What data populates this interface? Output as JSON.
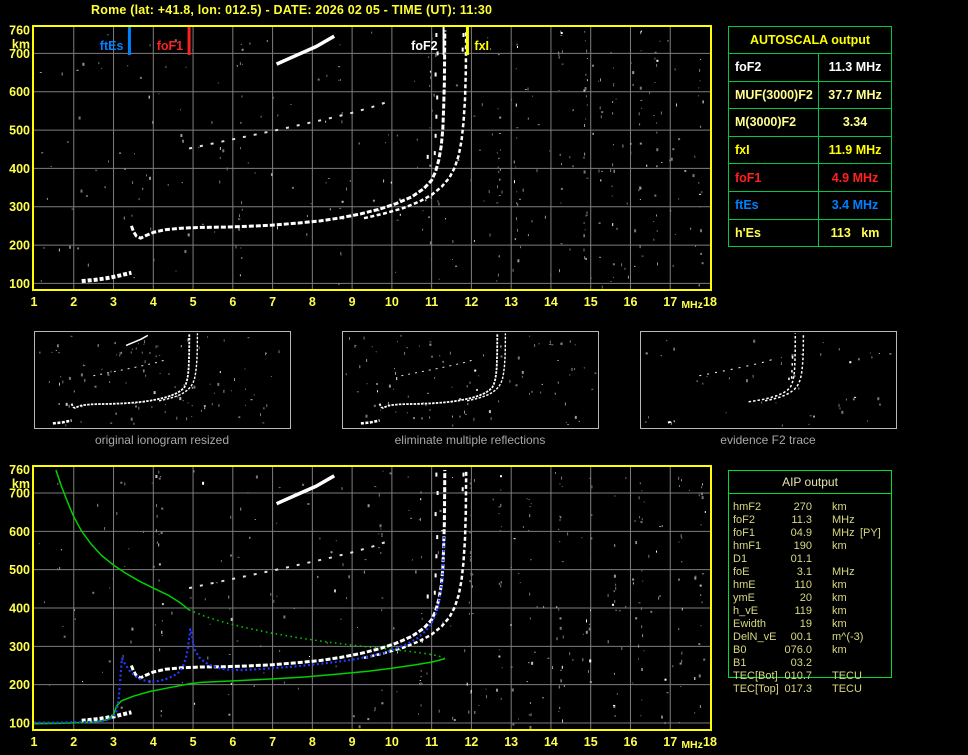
{
  "header": {
    "title": "Rome (lat: +41.8, lon: 012.5) - DATE: 2026 02 05 - TIME (UT): 11:30"
  },
  "colors": {
    "plot_border": "#ffff00",
    "grid": "#7d7d7d",
    "axis_text": "#ffff4d",
    "title_text": "#ffff33",
    "trace_white": "#ffffff",
    "hop_gray": "#e2e2e2",
    "fitted_blue": "#2438ff",
    "profile_green": "#00d000",
    "autoscala_border": "#00c846",
    "aip_border": "#00dc32",
    "aip_text": "#d8d880",
    "caption_gray": "#a8a8a8",
    "thumb_border": "#b8b8b8"
  },
  "autoscala_table": {
    "title": "AUTOSCALA output",
    "rows": [
      {
        "label": "foF2",
        "value": "11.3 MHz",
        "color": "#ffffff"
      },
      {
        "label": "MUF(3000)F2",
        "value": "37.7 MHz",
        "color": "#ffff8c"
      },
      {
        "label": "M(3000)F2",
        "value": "3.34",
        "color": "#ffff8c"
      },
      {
        "label": "fxI",
        "value": "11.9 MHz",
        "color": "#ffff00"
      },
      {
        "label": "foF1",
        "value": "4.9 MHz",
        "color": "#ff2020"
      },
      {
        "label": "ftEs",
        "value": "3.4 MHz",
        "color": "#0080ff"
      },
      {
        "label": "h'Es",
        "value": "113   km",
        "color": "#ffff4d"
      }
    ]
  },
  "aip_table": {
    "title": "AIP output",
    "rows": [
      [
        "hmF2",
        "270",
        "km",
        ""
      ],
      [
        "foF2",
        "11.3",
        "MHz",
        ""
      ],
      [
        "foF1",
        "04.9",
        "MHz",
        "[PY]"
      ],
      [
        "hmF1",
        "190",
        "km",
        ""
      ],
      [
        "D1",
        "01.1",
        "",
        ""
      ],
      [
        "foE",
        "3.1",
        "MHz",
        ""
      ],
      [
        "hmE",
        "110",
        "km",
        ""
      ],
      [
        "ymE",
        "20",
        "km",
        ""
      ],
      [
        "h_vE",
        "119",
        "km",
        ""
      ],
      [
        "Ewidth",
        "19",
        "km",
        ""
      ],
      [
        "DelN_vE",
        "00.1",
        "m^(-3)",
        ""
      ],
      [
        "B0",
        "076.0",
        "km",
        ""
      ],
      [
        "B1",
        "03.2",
        "",
        ""
      ],
      [
        "TEC[Bot]",
        "010.7",
        "TECU",
        ""
      ],
      [
        "TEC[Top]",
        "017.3",
        "TECU",
        ""
      ]
    ]
  },
  "thumbnails": [
    {
      "caption": "original ionogram resized"
    },
    {
      "caption": "eliminate multiple reflections"
    },
    {
      "caption": "evidence F2 trace"
    }
  ],
  "chart_data": {
    "type": "line",
    "x_axis": {
      "label": "MHz",
      "range": [
        1,
        18
      ],
      "ticks": [
        1,
        2,
        3,
        4,
        5,
        6,
        7,
        8,
        9,
        10,
        11,
        12,
        13,
        14,
        15,
        16,
        17,
        18
      ]
    },
    "y_axis": {
      "label": "km",
      "range": [
        100,
        760
      ],
      "top_label": "760",
      "ticks": [
        700,
        600,
        500,
        400,
        300,
        200,
        100
      ]
    },
    "markers": [
      {
        "label": "ftEs",
        "freq": 3.4,
        "color": "#0080ff",
        "side": "left"
      },
      {
        "label": "foF1",
        "freq": 4.9,
        "color": "#ff2020",
        "side": "left"
      },
      {
        "label": "foF2",
        "freq": 11.3,
        "color": "#ffffff",
        "side": "left"
      },
      {
        "label": "fxI",
        "freq": 11.9,
        "color": "#ffff00",
        "side": "right"
      }
    ],
    "ionogram_traces": {
      "es_layer": [
        [
          2.2,
          106
        ],
        [
          2.5,
          109
        ],
        [
          2.8,
          113
        ],
        [
          3.05,
          118
        ],
        [
          3.25,
          123
        ],
        [
          3.45,
          128
        ]
      ],
      "omode": [
        [
          3.45,
          250
        ],
        [
          3.5,
          236
        ],
        [
          3.57,
          224
        ],
        [
          3.68,
          218
        ],
        [
          3.82,
          225
        ],
        [
          4.0,
          233
        ],
        [
          4.3,
          240
        ],
        [
          4.7,
          244
        ],
        [
          5.2,
          246
        ],
        [
          5.8,
          247
        ],
        [
          6.4,
          249
        ],
        [
          7.0,
          252
        ],
        [
          7.6,
          257
        ],
        [
          8.2,
          263
        ],
        [
          8.7,
          271
        ],
        [
          9.2,
          281
        ],
        [
          9.7,
          294
        ],
        [
          10.1,
          308
        ],
        [
          10.5,
          326
        ],
        [
          10.8,
          347
        ],
        [
          11.0,
          369
        ],
        [
          11.1,
          392
        ],
        [
          11.18,
          422
        ],
        [
          11.24,
          458
        ],
        [
          11.28,
          502
        ],
        [
          11.3,
          555
        ],
        [
          11.32,
          625
        ],
        [
          11.33,
          760
        ]
      ],
      "xmode": [
        [
          9.3,
          270
        ],
        [
          9.8,
          282
        ],
        [
          10.3,
          297
        ],
        [
          10.7,
          314
        ],
        [
          11.0,
          331
        ],
        [
          11.25,
          352
        ],
        [
          11.45,
          376
        ],
        [
          11.58,
          402
        ],
        [
          11.68,
          434
        ],
        [
          11.75,
          472
        ],
        [
          11.8,
          520
        ],
        [
          11.84,
          580
        ],
        [
          11.86,
          650
        ],
        [
          11.87,
          760
        ]
      ],
      "second_hop": [
        [
          4.9,
          452
        ],
        [
          5.4,
          463
        ],
        [
          6.0,
          476
        ],
        [
          6.6,
          489
        ],
        [
          7.2,
          502
        ],
        [
          7.8,
          516
        ],
        [
          8.4,
          530
        ],
        [
          9.0,
          545
        ],
        [
          9.5,
          560
        ],
        [
          9.9,
          574
        ]
      ],
      "multi_hop_streak": [
        [
          7.1,
          672
        ],
        [
          7.6,
          695
        ],
        [
          8.1,
          718
        ],
        [
          8.55,
          745
        ]
      ],
      "asymptote_dots": [
        [
          10.9,
          430
        ],
        [
          11.08,
          440
        ],
        [
          11.1,
          485
        ],
        [
          11.12,
          535
        ],
        [
          11.14,
          585
        ],
        [
          11.1,
          645
        ],
        [
          11.15,
          700
        ],
        [
          11.12,
          748
        ],
        [
          11.78,
          710
        ],
        [
          11.8,
          748
        ]
      ]
    },
    "profile": {
      "topside_solid": [
        [
          1.55,
          760
        ],
        [
          1.7,
          715
        ],
        [
          1.85,
          675
        ],
        [
          2.0,
          638
        ],
        [
          2.2,
          600
        ],
        [
          2.45,
          565
        ],
        [
          2.7,
          537
        ],
        [
          3.0,
          512
        ],
        [
          3.3,
          491
        ],
        [
          3.65,
          470
        ],
        [
          4.0,
          452
        ],
        [
          4.4,
          432
        ],
        [
          4.7,
          412
        ],
        [
          4.9,
          395
        ]
      ],
      "topside_extrapolated": [
        [
          4.9,
          395
        ],
        [
          5.3,
          378
        ],
        [
          5.8,
          362
        ],
        [
          6.3,
          349
        ],
        [
          6.9,
          336
        ],
        [
          7.5,
          325
        ],
        [
          8.2,
          314
        ],
        [
          9.0,
          303
        ],
        [
          9.8,
          294
        ],
        [
          10.5,
          286
        ],
        [
          11.0,
          279
        ],
        [
          11.2,
          274
        ],
        [
          11.33,
          268
        ]
      ],
      "bottomside": [
        [
          1.0,
          98
        ],
        [
          1.6,
          99
        ],
        [
          2.2,
          101
        ],
        [
          2.6,
          104
        ],
        [
          2.85,
          109
        ],
        [
          3.0,
          122
        ],
        [
          3.08,
          145
        ],
        [
          3.2,
          158
        ],
        [
          3.5,
          170
        ],
        [
          3.9,
          182
        ],
        [
          4.4,
          192
        ],
        [
          4.9,
          202
        ],
        [
          5.2,
          206
        ],
        [
          5.6,
          208
        ],
        [
          6.2,
          211
        ],
        [
          7.0,
          215
        ],
        [
          7.8,
          220
        ],
        [
          8.6,
          227
        ],
        [
          9.4,
          235
        ],
        [
          10.0,
          243
        ],
        [
          10.6,
          252
        ],
        [
          11.0,
          259
        ],
        [
          11.2,
          264
        ],
        [
          11.33,
          268
        ]
      ]
    },
    "fitted_trace": [
      [
        1.0,
        101
      ],
      [
        1.3,
        101
      ],
      [
        1.6,
        101
      ],
      [
        1.9,
        102
      ],
      [
        2.2,
        102
      ],
      [
        2.5,
        103
      ],
      [
        2.7,
        105
      ],
      [
        2.85,
        108
      ],
      [
        2.95,
        113
      ],
      [
        3.02,
        120
      ],
      [
        3.07,
        130
      ],
      [
        3.1,
        145
      ],
      [
        3.13,
        165
      ],
      [
        3.15,
        190
      ],
      [
        3.17,
        215
      ],
      [
        3.19,
        242
      ],
      [
        3.21,
        268
      ],
      [
        3.3,
        252
      ],
      [
        3.42,
        234
      ],
      [
        3.55,
        222
      ],
      [
        3.7,
        213
      ],
      [
        3.9,
        208
      ],
      [
        4.1,
        209
      ],
      [
        4.3,
        214
      ],
      [
        4.5,
        222
      ],
      [
        4.65,
        233
      ],
      [
        4.75,
        248
      ],
      [
        4.82,
        270
      ],
      [
        4.87,
        295
      ],
      [
        4.9,
        320
      ],
      [
        4.93,
        345
      ],
      [
        4.97,
        330
      ],
      [
        5.0,
        310
      ],
      [
        5.05,
        290
      ],
      [
        5.15,
        272
      ],
      [
        5.3,
        258
      ],
      [
        5.5,
        248
      ],
      [
        5.7,
        242
      ],
      [
        5.9,
        239
      ],
      [
        6.2,
        238
      ],
      [
        6.6,
        240
      ],
      [
        7.0,
        243
      ],
      [
        7.5,
        247
      ],
      [
        8.0,
        252
      ],
      [
        8.5,
        258
      ],
      [
        9.0,
        265
      ],
      [
        9.4,
        273
      ],
      [
        9.8,
        283
      ],
      [
        10.1,
        294
      ],
      [
        10.4,
        307
      ],
      [
        10.65,
        322
      ],
      [
        10.85,
        340
      ],
      [
        11.0,
        360
      ],
      [
        11.1,
        382
      ],
      [
        11.17,
        408
      ],
      [
        11.22,
        438
      ],
      [
        11.26,
        470
      ],
      [
        11.28,
        505
      ],
      [
        11.3,
        545
      ],
      [
        11.31,
        590
      ]
    ]
  }
}
